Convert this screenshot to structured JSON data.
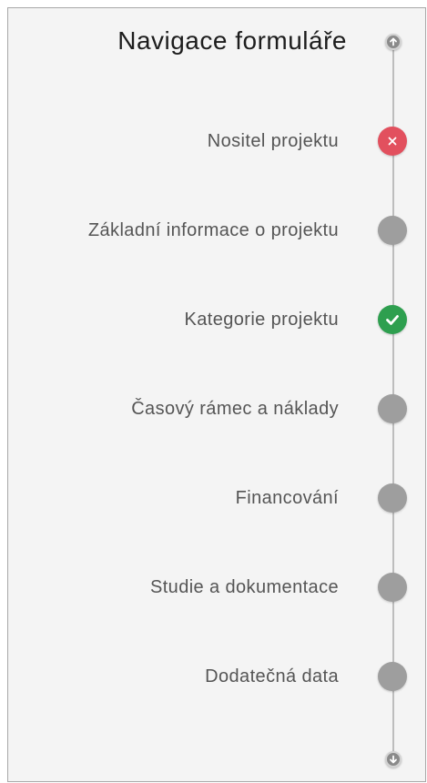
{
  "nav": {
    "title": "Navigace formuláře",
    "up_icon": "arrow-up-icon",
    "down_icon": "arrow-down-icon",
    "colors": {
      "pending": "#9e9e9e",
      "error": "#e2505e",
      "done": "#2e9f4f"
    },
    "steps": [
      {
        "label": "Nositel projektu",
        "status": "error",
        "icon": "close-icon"
      },
      {
        "label": "Základní informace o projektu",
        "status": "pending",
        "icon": ""
      },
      {
        "label": "Kategorie projektu",
        "status": "done",
        "icon": "check-icon"
      },
      {
        "label": "Časový rámec a náklady",
        "status": "pending",
        "icon": ""
      },
      {
        "label": "Financování",
        "status": "pending",
        "icon": ""
      },
      {
        "label": "Studie a dokumentace",
        "status": "pending",
        "icon": ""
      },
      {
        "label": "Dodatečná data",
        "status": "pending",
        "icon": ""
      }
    ]
  }
}
